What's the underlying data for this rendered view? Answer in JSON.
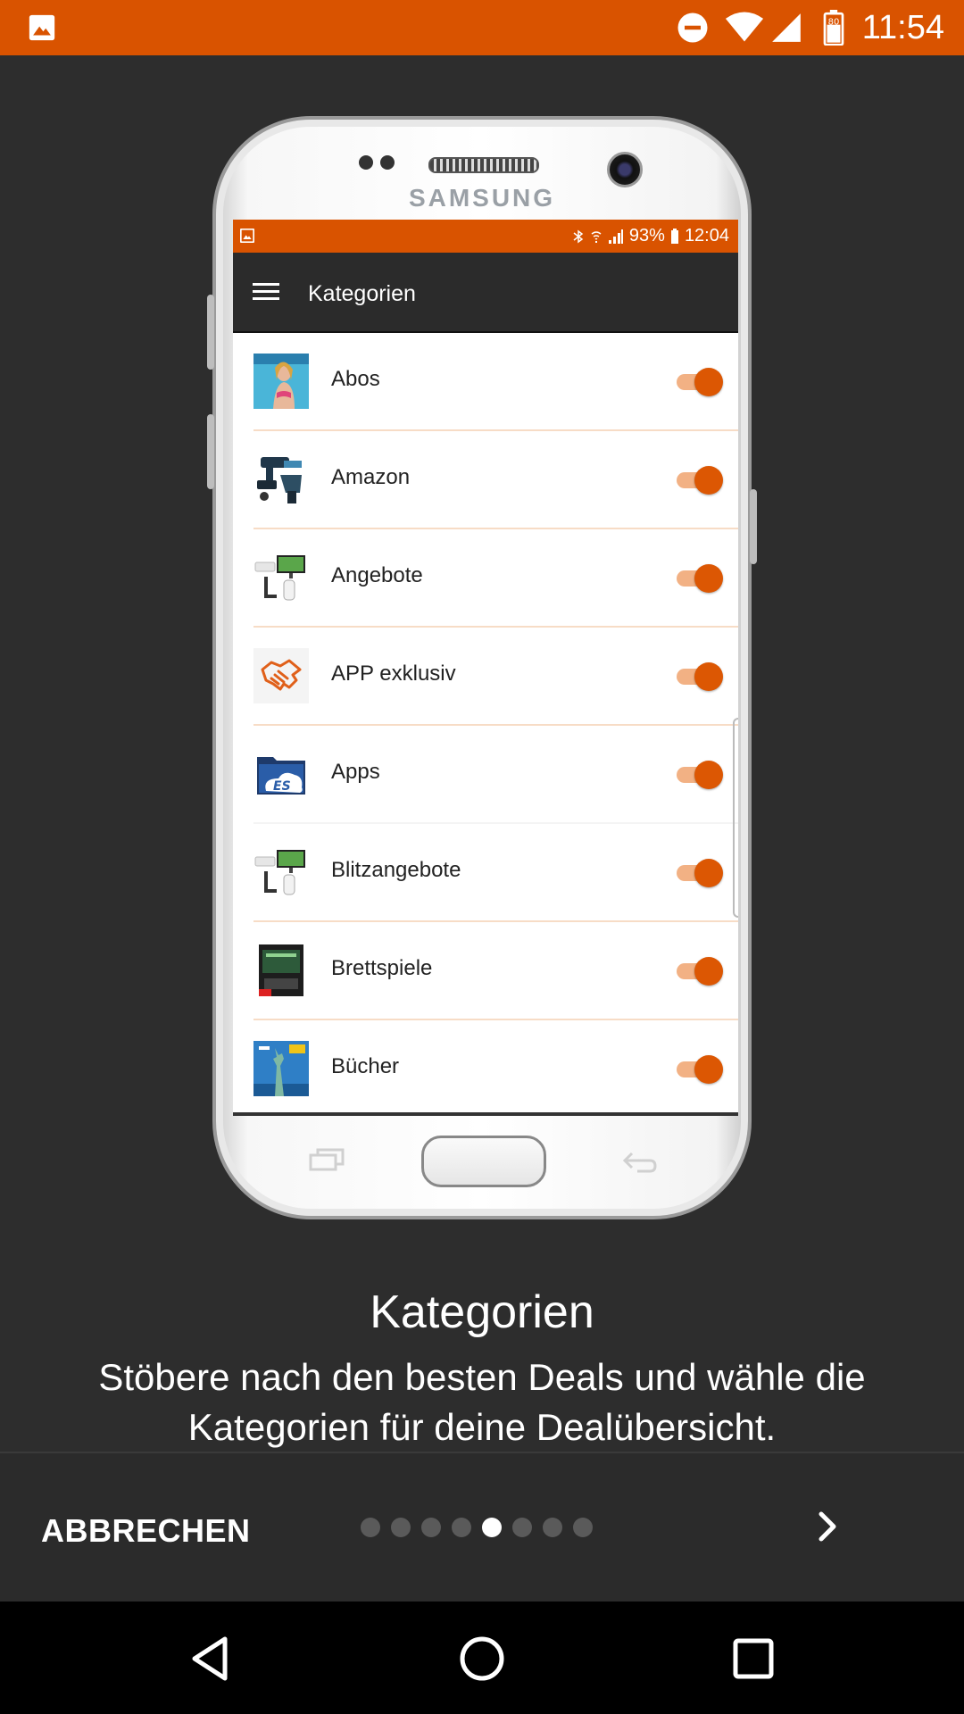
{
  "status_bar": {
    "time": "11:54",
    "battery_level": "80",
    "icons": [
      "gallery-icon",
      "do-not-disturb-icon",
      "wifi-icon",
      "signal-icon",
      "battery-icon"
    ],
    "color": "#d95300"
  },
  "phone": {
    "brand": "SAMSUNG",
    "inner_status": {
      "battery": "93%",
      "time": "12:04"
    },
    "app_bar_title": "Kategorien",
    "categories": [
      {
        "label": "Abos",
        "enabled": true,
        "icon": "magazine-thumb"
      },
      {
        "label": "Amazon",
        "enabled": true,
        "icon": "tools-thumb"
      },
      {
        "label": "Angebote",
        "enabled": true,
        "icon": "devices-thumb"
      },
      {
        "label": "APP exklusiv",
        "enabled": true,
        "icon": "handshake-thumb"
      },
      {
        "label": "Apps",
        "enabled": true,
        "icon": "es-file-explorer-thumb"
      },
      {
        "label": "Blitzangebote",
        "enabled": true,
        "icon": "devices-thumb"
      },
      {
        "label": "Brettspiele",
        "enabled": true,
        "icon": "boardgame-thumb"
      },
      {
        "label": "Bücher",
        "enabled": true,
        "icon": "statue-of-liberty-thumb"
      }
    ]
  },
  "onboarding": {
    "title": "Kategorien",
    "description": "Stöbere nach den besten Deals und wähle die Kategorien für deine Dealübersicht.",
    "cancel_label": "ABBRECHEN",
    "page_count": 8,
    "current_page": 5,
    "next_icon": "chevron-right-icon"
  },
  "nav_bar": {
    "icons": [
      "back-icon",
      "home-icon",
      "recents-icon"
    ]
  },
  "colors": {
    "accent": "#d95300",
    "background": "#2d2d2d",
    "toggle_on": "#dc5703"
  }
}
